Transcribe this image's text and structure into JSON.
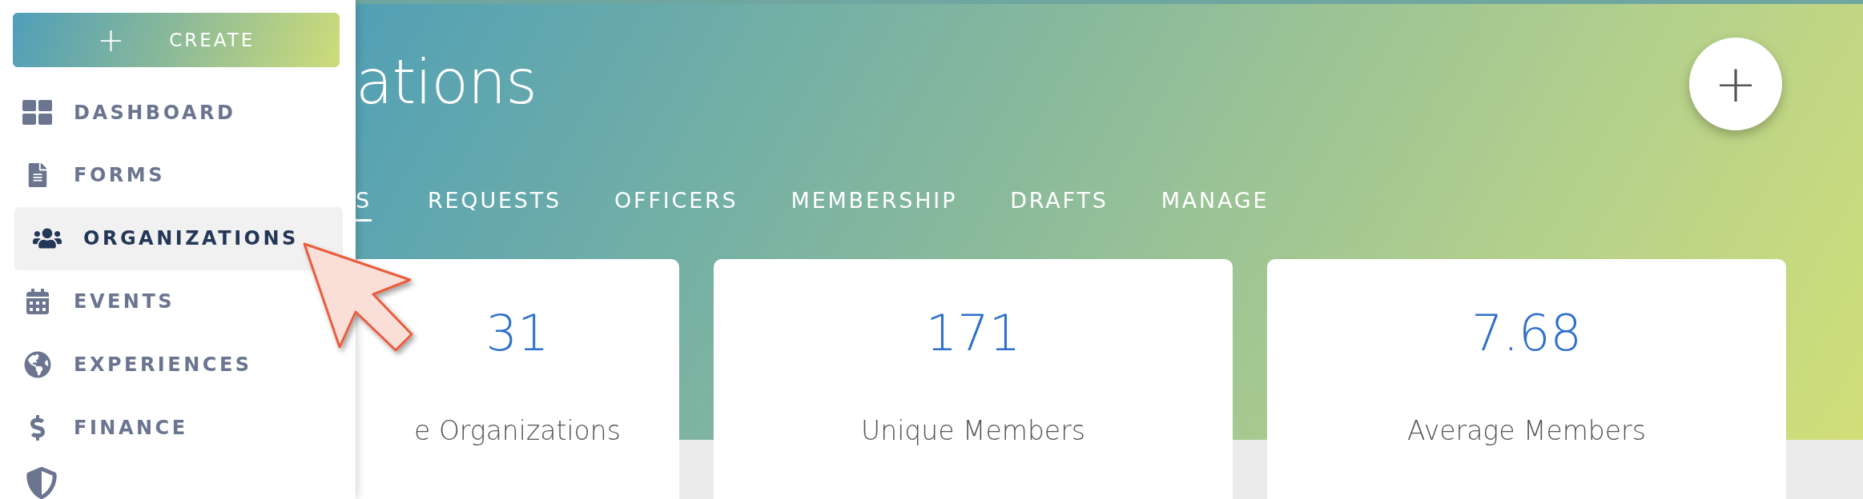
{
  "sidebar": {
    "create_button": {
      "icon_text": "+",
      "label": "CREATE"
    },
    "items": [
      {
        "label": "DASHBOARD",
        "selected": false
      },
      {
        "label": "FORMS",
        "selected": false
      },
      {
        "label": "ORGANIZATIONS",
        "selected": true
      },
      {
        "label": "EVENTS",
        "selected": false
      },
      {
        "label": "EXPERIENCES",
        "selected": false
      },
      {
        "label": "FINANCE",
        "selected": false
      }
    ]
  },
  "header": {
    "title": "ations",
    "add_button": "+"
  },
  "tabs": [
    {
      "label": "S",
      "selected": true
    },
    {
      "label": "REQUESTS",
      "selected": false
    },
    {
      "label": "OFFICERS",
      "selected": false
    },
    {
      "label": "MEMBERSHIP",
      "selected": false
    },
    {
      "label": "DRAFTS",
      "selected": false
    },
    {
      "label": "MANAGE",
      "selected": false
    }
  ],
  "stats": [
    {
      "value": "31",
      "label": "e Organizations"
    },
    {
      "value": "171",
      "label": "Unique Members"
    },
    {
      "value": "7.68",
      "label": "Average Members"
    }
  ]
}
